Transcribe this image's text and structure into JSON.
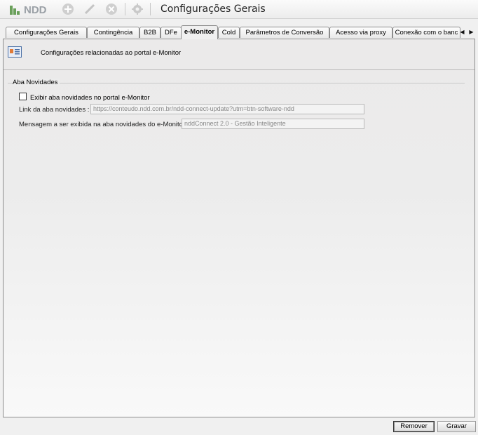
{
  "window": {
    "title": "Configurações Gerais",
    "logo_text": "NDD"
  },
  "toolbar": {
    "icons": [
      "add-icon",
      "edit-icon",
      "remove-icon",
      "settings-icon"
    ]
  },
  "tabs": [
    {
      "label": "Configurações Gerais",
      "active": false
    },
    {
      "label": "Contingência",
      "active": false
    },
    {
      "label": "B2B",
      "active": false
    },
    {
      "label": "DFe",
      "active": false
    },
    {
      "label": "e-Monitor",
      "active": true
    },
    {
      "label": "Cold",
      "active": false
    },
    {
      "label": "Parâmetros de Conversão",
      "active": false
    },
    {
      "label": "Acesso via proxy",
      "active": false
    },
    {
      "label": "Conexão com o banc",
      "active": false
    }
  ],
  "header": {
    "description": "Configurações relacionadas ao portal e-Monitor"
  },
  "group": {
    "title": "Aba Novidades",
    "checkbox_label": "Exibir aba novidades no portal e-Monitor",
    "checkbox_checked": false,
    "link_label": "Link da aba novidades :",
    "link_value": "https://conteudo.ndd.com.br/ndd-connect-update?utm=btn-software-ndd",
    "message_label": "Mensagem a ser exibida na aba novidades do e-Monitor:",
    "message_value": "nddConnect 2.0 - Gestão Inteligente"
  },
  "buttons": {
    "remove": "Remover",
    "save": "Gravar"
  }
}
